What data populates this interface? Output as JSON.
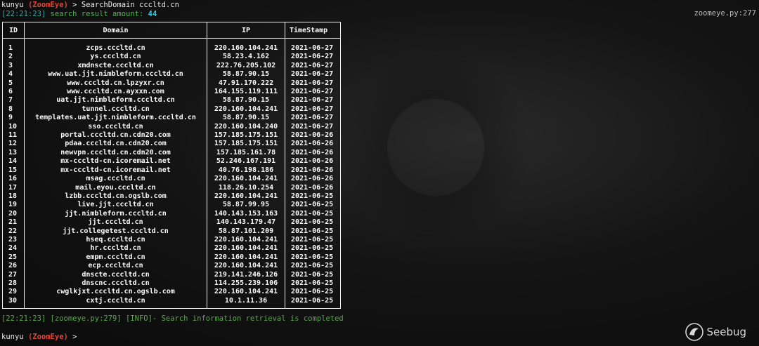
{
  "prompt1": {
    "user": "kunyu",
    "app": "(ZoomEye)",
    "arrow": ">",
    "command": "SearchDomain cccltd.cn"
  },
  "status": {
    "time": "[22:21:23]",
    "text": "search result amount:",
    "count": "44",
    "source": "zoomeye.py:277"
  },
  "table": {
    "headers": [
      "ID",
      "Domain",
      "IP",
      "TimeStamp"
    ],
    "rows": [
      [
        "1",
        "zcps.cccltd.cn",
        "220.160.104.241",
        "2021-06-27"
      ],
      [
        "2",
        "ys.cccltd.cn",
        "58.23.4.162",
        "2021-06-27"
      ],
      [
        "3",
        "xmdnscte.cccltd.cn",
        "222.76.205.102",
        "2021-06-27"
      ],
      [
        "4",
        "www.uat.jjt.nimbleform.cccltd.cn",
        "58.87.90.15",
        "2021-06-27"
      ],
      [
        "5",
        "www.cccltd.cn.lpzyxr.cn",
        "47.91.170.222",
        "2021-06-27"
      ],
      [
        "6",
        "www.cccltd.cn.ayxxn.com",
        "164.155.119.111",
        "2021-06-27"
      ],
      [
        "7",
        "uat.jjt.nimbleform.cccltd.cn",
        "58.87.90.15",
        "2021-06-27"
      ],
      [
        "8",
        "tunnel.cccltd.cn",
        "220.160.104.241",
        "2021-06-27"
      ],
      [
        "9",
        "templates.uat.jjt.nimbleform.cccltd.cn",
        "58.87.90.15",
        "2021-06-27"
      ],
      [
        "10",
        "sso.cccltd.cn",
        "220.160.104.240",
        "2021-06-27"
      ],
      [
        "11",
        "portal.cccltd.cn.cdn20.com",
        "157.185.175.151",
        "2021-06-26"
      ],
      [
        "12",
        "pdaa.cccltd.cn.cdn20.com",
        "157.185.175.151",
        "2021-06-26"
      ],
      [
        "13",
        "newvpn.cccltd.cn.cdn20.com",
        "157.185.161.78",
        "2021-06-26"
      ],
      [
        "14",
        "mx-cccltd-cn.icoremail.net",
        "52.246.167.191",
        "2021-06-26"
      ],
      [
        "15",
        "mx-cccltd-cn.icoremail.net",
        "40.76.198.186",
        "2021-06-26"
      ],
      [
        "16",
        "msag.cccltd.cn",
        "220.160.104.241",
        "2021-06-26"
      ],
      [
        "17",
        "mail.eyou.cccltd.cn",
        "118.26.10.254",
        "2021-06-26"
      ],
      [
        "18",
        "lzbb.cccltd.cn.ogslb.com",
        "220.160.104.241",
        "2021-06-25"
      ],
      [
        "19",
        "live.jjt.cccltd.cn",
        "58.87.99.95",
        "2021-06-25"
      ],
      [
        "20",
        "jjt.nimbleform.cccltd.cn",
        "140.143.153.163",
        "2021-06-25"
      ],
      [
        "21",
        "jjt.cccltd.cn",
        "140.143.179.47",
        "2021-06-25"
      ],
      [
        "22",
        "jjt.collegetest.cccltd.cn",
        "58.87.101.209",
        "2021-06-25"
      ],
      [
        "23",
        "hseq.cccltd.cn",
        "220.160.104.241",
        "2021-06-25"
      ],
      [
        "24",
        "hr.cccltd.cn",
        "220.160.104.241",
        "2021-06-25"
      ],
      [
        "25",
        "empm.cccltd.cn",
        "220.160.104.241",
        "2021-06-25"
      ],
      [
        "26",
        "ecp.cccltd.cn",
        "220.160.104.241",
        "2021-06-25"
      ],
      [
        "27",
        "dnscte.cccltd.cn",
        "219.141.246.126",
        "2021-06-25"
      ],
      [
        "28",
        "dnscnc.cccltd.cn",
        "114.255.239.106",
        "2021-06-25"
      ],
      [
        "29",
        "cwglkjxt.cccltd.cn.ogslb.com",
        "220.160.104.241",
        "2021-06-25"
      ],
      [
        "30",
        "cxtj.cccltd.cn",
        "10.1.11.36",
        "2021-06-25"
      ]
    ]
  },
  "log": {
    "text": "[22:21:23] [zoomeye.py:279] [INFO]- Search information retrieval is completed"
  },
  "prompt2": {
    "user": "kunyu",
    "app": "(ZoomEye)",
    "arrow": ">"
  },
  "watermark": {
    "brand": "Seebug",
    "icon": "seebug-logo-icon"
  }
}
